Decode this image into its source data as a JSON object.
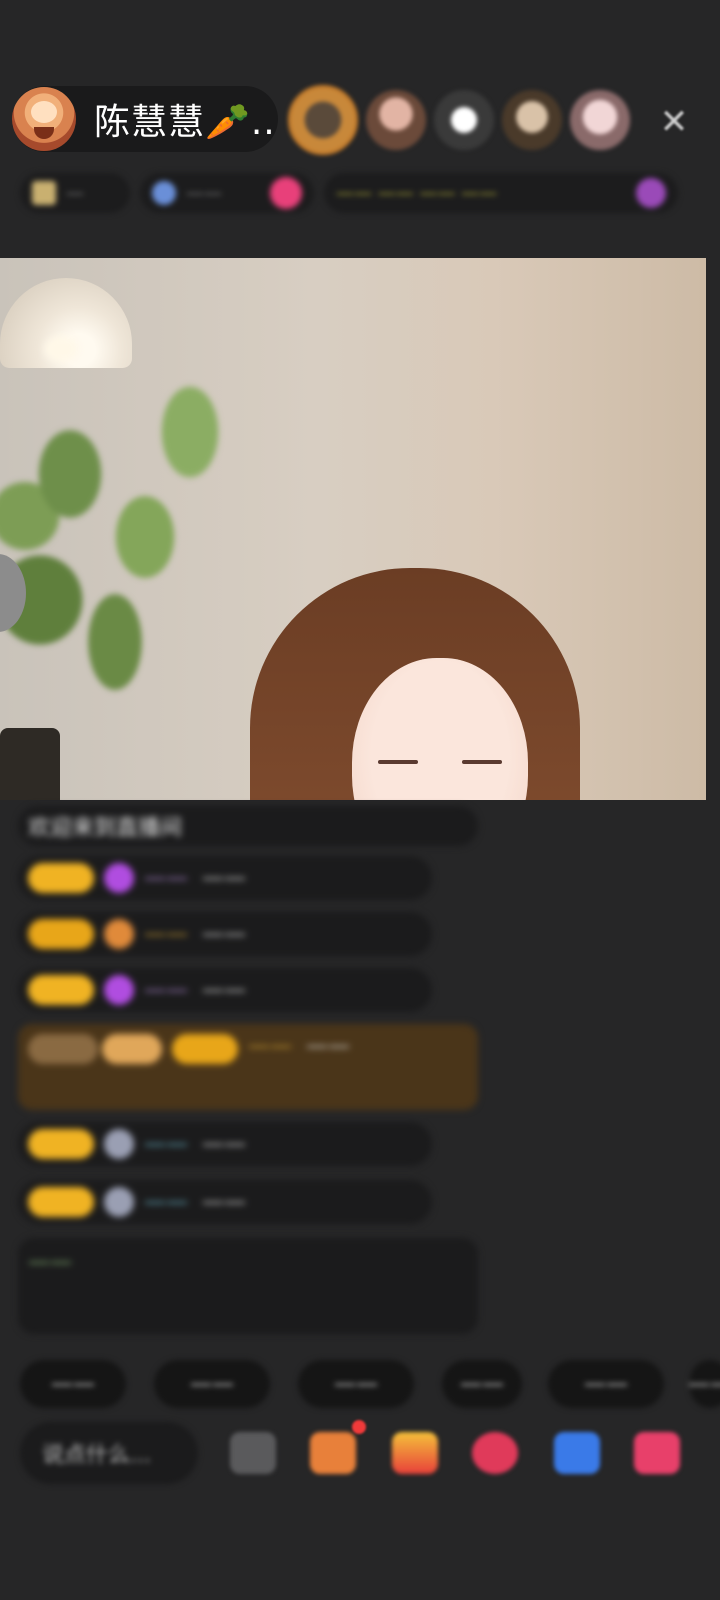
{
  "header": {
    "host_name": "陈慧慧🥕...",
    "close_icon": "close-icon"
  },
  "viewers": [
    {
      "icon": "viewer-avatar"
    },
    {
      "icon": "viewer-avatar"
    },
    {
      "icon": "viewer-avatar"
    },
    {
      "icon": "viewer-avatar"
    },
    {
      "icon": "viewer-avatar"
    }
  ],
  "info_bar": {
    "chip1": "—",
    "chip2": "——",
    "chip3": "——  ——  ——  ——"
  },
  "chat": [
    {
      "text": "欢迎来到直播间"
    },
    {
      "name": "——",
      "text": "——"
    },
    {
      "name": "——",
      "text": "——"
    },
    {
      "name": "——",
      "text": "——"
    },
    {
      "name": "——",
      "text": "——"
    },
    {
      "name": "——",
      "text": "——"
    },
    {
      "name": "——",
      "text": "——"
    },
    {
      "text": "——"
    }
  ],
  "quick_replies": [
    "——",
    "——",
    "——",
    "——",
    "——",
    "——"
  ],
  "bottom_bar": {
    "say_placeholder": "说点什么..."
  },
  "colors": {
    "background": "#262627",
    "badge_gold": "#f0b323",
    "accent_pink": "#e8407a"
  }
}
